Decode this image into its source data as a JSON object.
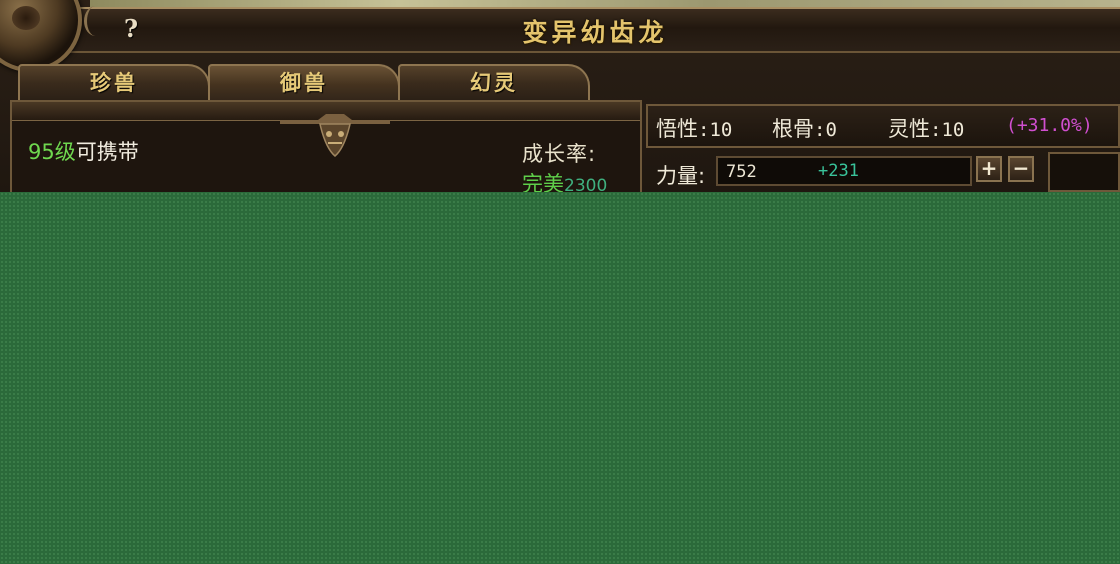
{
  "window": {
    "title": "变异幼齿龙",
    "help_label": "?"
  },
  "tabs": [
    {
      "label": "珍兽",
      "active": false
    },
    {
      "label": "御兽",
      "active": true
    },
    {
      "label": "幻灵",
      "active": false
    }
  ],
  "pet_info": {
    "level_number": "95级",
    "carry_text": "可携带",
    "growth_label": "成长率:",
    "growth_grade": "完美",
    "growth_value": "2300"
  },
  "attributes": {
    "comprehension": {
      "label": "悟性",
      "value": "10"
    },
    "root_bone": {
      "label": "根骨",
      "value": "0"
    },
    "spirituality": {
      "label": "灵性",
      "value": "10"
    },
    "bonus": "(+31.0%)"
  },
  "strength": {
    "label": "力量:",
    "value": "752",
    "added": "+231",
    "plus_label": "+",
    "minus_label": "−"
  },
  "colors": {
    "title_gold": "#e4c46c",
    "level_green": "#6fd84f",
    "bonus_magenta": "#d04fd0",
    "added_teal": "#39c39a",
    "overlay_green": "#2b6a3a"
  }
}
